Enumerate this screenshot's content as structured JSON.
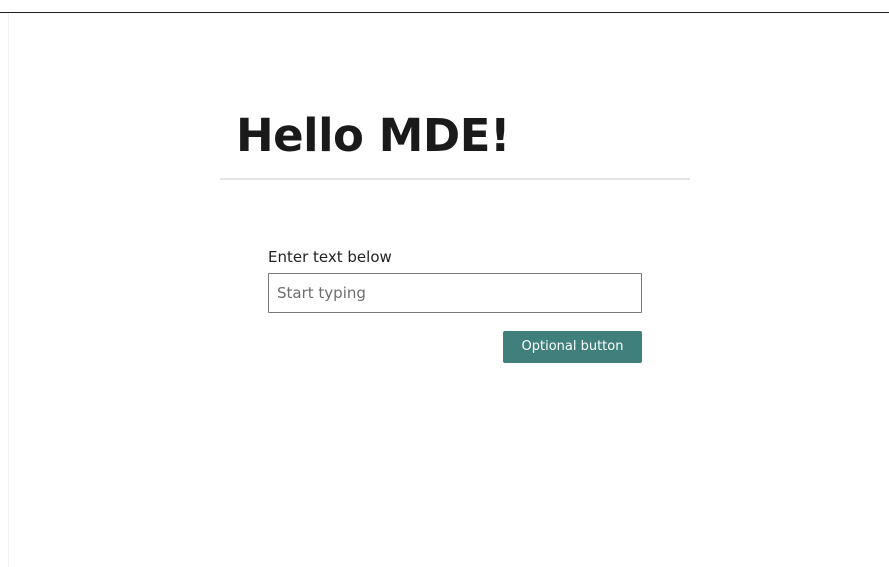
{
  "page": {
    "title": "Hello MDE!"
  },
  "form": {
    "label": "Enter text below",
    "input_value": "",
    "input_placeholder": "Start typing",
    "button_label": "Optional button"
  },
  "colors": {
    "button_background": "#3f7f7c",
    "button_text": "#ffffff",
    "title_text": "#1a1a1a",
    "divider": "#e3e3e3",
    "top_rule": "#1f1f1f"
  }
}
